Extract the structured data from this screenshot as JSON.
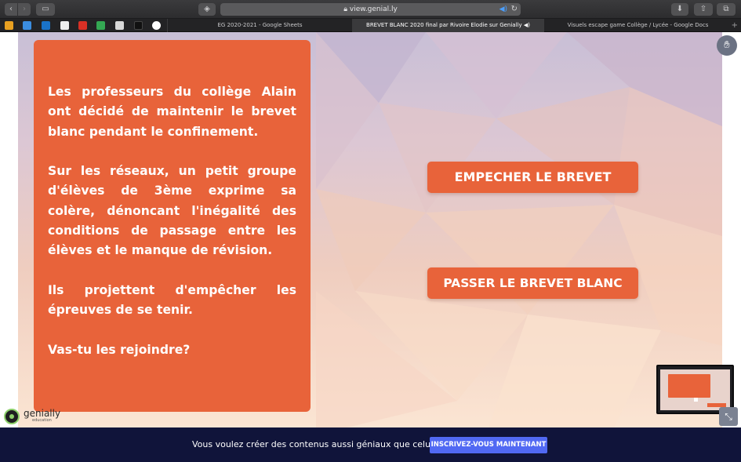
{
  "browser": {
    "url": "view.genial.ly",
    "lock_icon": "lock-icon",
    "audio_icon": "speaker-icon",
    "reload_icon": "reload-icon"
  },
  "tabs": [
    {
      "label": "EG 2020-2021 - Google Sheets",
      "active": false
    },
    {
      "label": "BREVET BLANC 2020 final par Rivoire Elodie sur Genially",
      "active": true
    },
    {
      "label": "Visuels escape game Collège / Lycée - Google Docs",
      "active": false
    }
  ],
  "favorites_icons": [
    "bookmark-icon",
    "pocket-icon",
    "outlook-icon",
    "pinterest-icon",
    "gmail-icon",
    "drive-icon",
    "notes-icon",
    "dark-icon",
    "google-icon"
  ],
  "slide": {
    "paragraphs": [
      "Les professeurs du collège  Alain ont décidé de maintenir le brevet blanc pendant le confinement.",
      "Sur les réseaux, un petit groupe d'élèves de 3ème exprime sa colère, dénoncant l'inégalité des conditions de  passage entre les élèves et le manque de révision.",
      "Ils projettent d'empêcher les épreuves de se tenir.",
      "Vas-tu les rejoindre?"
    ],
    "choice_1": "EMPECHER LE BREVET",
    "choice_2": "PASSER LE BREVET BLANC",
    "brand_name": "genially",
    "brand_sub": "education"
  },
  "banner": {
    "text": "Vous voulez créer des contenus aussi géniaux que celui-ci ?",
    "cta": "INSCRIVEZ-VOUS MAINTENANT"
  },
  "colors": {
    "accent": "#e8633a",
    "banner_bg": "#10143a",
    "cta": "#5169f3"
  }
}
